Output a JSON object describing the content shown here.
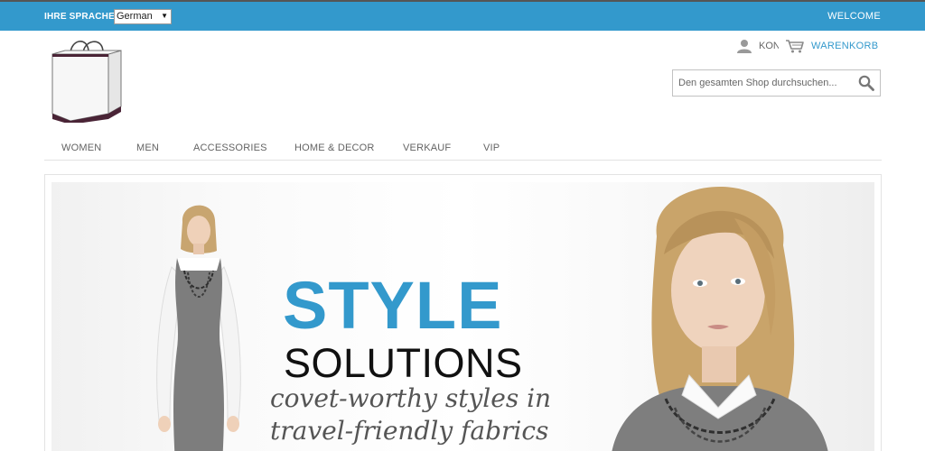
{
  "topbar": {
    "language_label": "IHRE SPRACHE:",
    "language_selected": "German",
    "welcome": "WELCOME"
  },
  "header": {
    "account_label": "KONTO",
    "cart_label": "WARENKORB",
    "search_placeholder": "Den gesamten Shop durchsuchen..."
  },
  "nav": {
    "items": [
      {
        "label": "WOMEN"
      },
      {
        "label": "MEN"
      },
      {
        "label": "ACCESSORIES"
      },
      {
        "label": "HOME & DECOR"
      },
      {
        "label": "VERKAUF"
      },
      {
        "label": "VIP"
      }
    ]
  },
  "hero": {
    "headline": "STYLE",
    "subheadline": "SOLUTIONS",
    "tagline_line1": "covet-worthy styles in",
    "tagline_line2": "travel-friendly fabrics"
  },
  "colors": {
    "accent": "#3399cc",
    "nav_text": "#636363"
  },
  "icons": [
    "user-icon",
    "cart-icon",
    "search-icon",
    "shopping-bag-logo"
  ]
}
